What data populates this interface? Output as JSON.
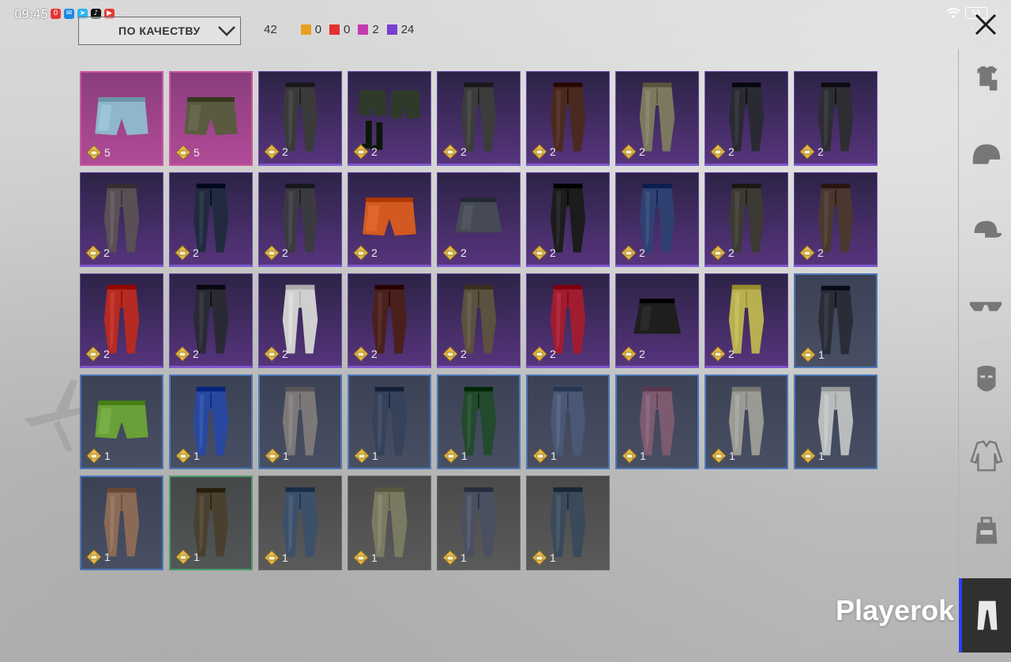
{
  "status_bar": {
    "time": "09:45",
    "battery": "68",
    "apps": [
      {
        "icon": "notification-app-icon",
        "color": "#e53935",
        "glyph": "0"
      },
      {
        "icon": "mail-app-icon",
        "color": "#1e88e5",
        "glyph": "✉"
      },
      {
        "icon": "telegram-app-icon",
        "color": "#29b6f6",
        "glyph": "➤"
      },
      {
        "icon": "tiktok-app-icon",
        "color": "#111111",
        "glyph": "♪"
      },
      {
        "icon": "youtube-app-icon",
        "color": "#e53935",
        "glyph": "▶"
      },
      {
        "icon": "more-notifications-icon",
        "color": "transparent",
        "glyph": "···"
      }
    ]
  },
  "sort": {
    "label": "ПО КАЧЕСТВУ"
  },
  "summary": {
    "total": "42",
    "quality_counts": [
      {
        "color": "#e8a020",
        "count": "0"
      },
      {
        "color": "#e53030",
        "count": "0"
      },
      {
        "color": "#c43bb0",
        "count": "2"
      },
      {
        "color": "#7a3fd0",
        "count": "24"
      }
    ]
  },
  "items": [
    {
      "quality": "pink",
      "count": "5",
      "kind": "denim-shorts",
      "color": "#8fb7cc"
    },
    {
      "quality": "pink",
      "count": "5",
      "kind": "camo-shorts",
      "color": "#5a5a40"
    },
    {
      "quality": "purple",
      "count": "2",
      "kind": "pants",
      "color": "#3a3a3a"
    },
    {
      "quality": "purple",
      "count": "2",
      "kind": "shorts-set",
      "color": "#2f3a2a"
    },
    {
      "quality": "purple",
      "count": "2",
      "kind": "pants",
      "color": "#3c3c3c"
    },
    {
      "quality": "purple",
      "count": "2",
      "kind": "pants",
      "color": "#4a2a20"
    },
    {
      "quality": "purple",
      "count": "2",
      "kind": "pants",
      "color": "#7c7860"
    },
    {
      "quality": "purple",
      "count": "2",
      "kind": "pants",
      "color": "#2a2a33"
    },
    {
      "quality": "purple",
      "count": "2",
      "kind": "pants",
      "color": "#2d2d33"
    },
    {
      "quality": "purple",
      "count": "2",
      "kind": "pants",
      "color": "#5a4f55"
    },
    {
      "quality": "purple",
      "count": "2",
      "kind": "pants",
      "color": "#222a40"
    },
    {
      "quality": "purple",
      "count": "2",
      "kind": "pants",
      "color": "#3a3a40"
    },
    {
      "quality": "purple",
      "count": "2",
      "kind": "shorts",
      "color": "#d25a20"
    },
    {
      "quality": "purple",
      "count": "2",
      "kind": "skirt",
      "color": "#454a55"
    },
    {
      "quality": "purple",
      "count": "2",
      "kind": "pants",
      "color": "#1c1c1c"
    },
    {
      "quality": "purple",
      "count": "2",
      "kind": "pants",
      "color": "#2e4170"
    },
    {
      "quality": "purple",
      "count": "2",
      "kind": "pants",
      "color": "#3c3a33"
    },
    {
      "quality": "purple",
      "count": "2",
      "kind": "pants",
      "color": "#4a3830"
    },
    {
      "quality": "purple",
      "count": "2",
      "kind": "pants",
      "color": "#b52a22"
    },
    {
      "quality": "purple",
      "count": "2",
      "kind": "pants",
      "color": "#2a2a35"
    },
    {
      "quality": "purple",
      "count": "2",
      "kind": "pants",
      "color": "#cfcfcf"
    },
    {
      "quality": "purple",
      "count": "2",
      "kind": "pants",
      "color": "#4a201c"
    },
    {
      "quality": "purple",
      "count": "2",
      "kind": "pants",
      "color": "#5c5040"
    },
    {
      "quality": "purple",
      "count": "2",
      "kind": "pants",
      "color": "#a01c30"
    },
    {
      "quality": "purple",
      "count": "2",
      "kind": "skirt",
      "color": "#1e1e1e"
    },
    {
      "quality": "purple",
      "count": "2",
      "kind": "pants",
      "color": "#b8b050"
    },
    {
      "quality": "blue",
      "count": "1",
      "kind": "pants",
      "color": "#2a2d38"
    },
    {
      "quality": "blue",
      "count": "1",
      "kind": "shorts",
      "color": "#6aa038"
    },
    {
      "quality": "blue",
      "count": "1",
      "kind": "pants",
      "color": "#2848a0"
    },
    {
      "quality": "blue",
      "count": "1",
      "kind": "pants",
      "color": "#7c7878"
    },
    {
      "quality": "blue",
      "count": "1",
      "kind": "pants",
      "color": "#35425a"
    },
    {
      "quality": "blue",
      "count": "1",
      "kind": "pants",
      "color": "#234a2c"
    },
    {
      "quality": "blue",
      "count": "1",
      "kind": "pants",
      "color": "#4a5875"
    },
    {
      "quality": "blue",
      "count": "1",
      "kind": "pants",
      "color": "#7c5a70"
    },
    {
      "quality": "blue",
      "count": "1",
      "kind": "pants",
      "color": "#9a9a94"
    },
    {
      "quality": "blue",
      "count": "1",
      "kind": "pants",
      "color": "#b8bcbc"
    },
    {
      "quality": "blue",
      "count": "1",
      "kind": "pants",
      "color": "#8a6a55"
    },
    {
      "quality": "green",
      "count": "1",
      "kind": "pants",
      "color": "#4a4030"
    },
    {
      "quality": "gray",
      "count": "1",
      "kind": "pants",
      "color": "#3c506a"
    },
    {
      "quality": "gray",
      "count": "1",
      "kind": "pants",
      "color": "#7a7a62"
    },
    {
      "quality": "gray",
      "count": "1",
      "kind": "pants",
      "color": "#4a5060"
    },
    {
      "quality": "gray",
      "count": "1",
      "kind": "pants",
      "color": "#3a4a5a"
    }
  ],
  "sidebar": {
    "categories": [
      {
        "icon": "outfit-icon",
        "active": false
      },
      {
        "icon": "helmet-icon",
        "active": false
      },
      {
        "icon": "cap-icon",
        "active": false
      },
      {
        "icon": "glasses-icon",
        "active": false
      },
      {
        "icon": "mask-icon",
        "active": false
      },
      {
        "icon": "jacket-icon",
        "active": false
      },
      {
        "icon": "backpack-icon",
        "active": false
      },
      {
        "icon": "pants-icon",
        "active": true
      }
    ]
  },
  "watermark": "Playerok"
}
